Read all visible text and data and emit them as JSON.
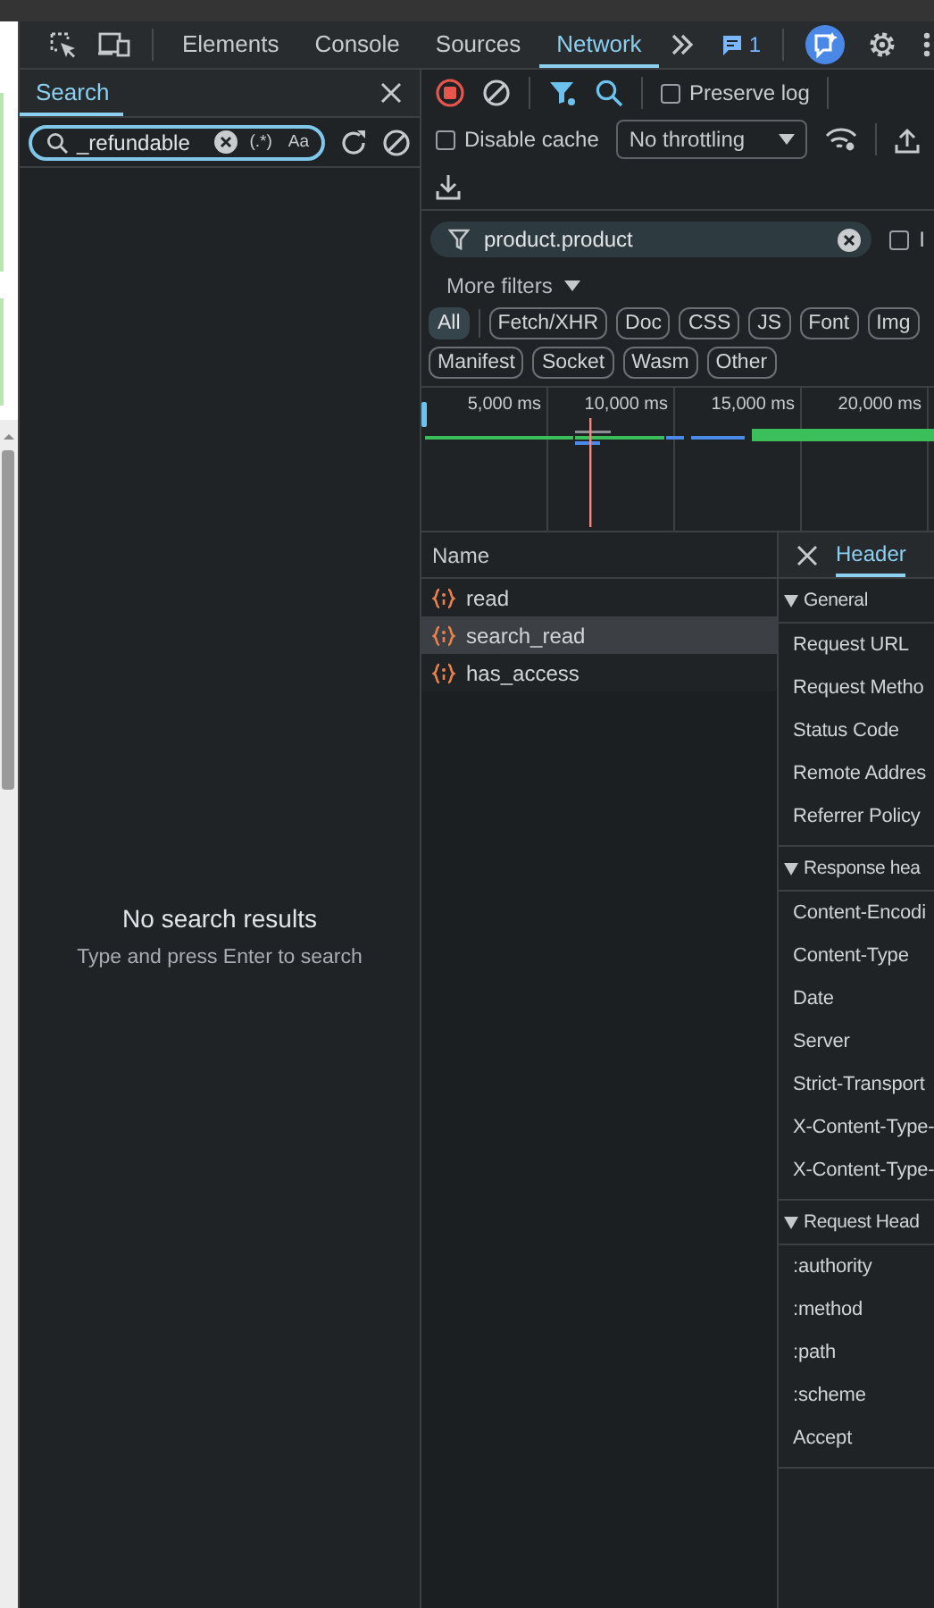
{
  "toolbar": {
    "tabs": [
      {
        "label": "Elements",
        "selected": false
      },
      {
        "label": "Console",
        "selected": false
      },
      {
        "label": "Sources",
        "selected": false
      },
      {
        "label": "Network",
        "selected": true
      }
    ],
    "message_count": "1"
  },
  "search_panel": {
    "tab": {
      "label": "Search",
      "selected": true
    },
    "query": "_refundable",
    "regex_toggle": "(.*)",
    "case_toggle": "Aa",
    "empty_title": "No search results",
    "empty_hint": "Type and press Enter to search"
  },
  "network": {
    "preserve_log": {
      "label": "Preserve log",
      "checked": false
    },
    "disable_cache": {
      "label": "Disable cache",
      "checked": false
    },
    "throttling": "No throttling",
    "filter": {
      "value": "product.product"
    },
    "invert": {
      "label": "I",
      "checked": false
    },
    "more_filters": "More filters",
    "type_filters": [
      {
        "label": "All",
        "selected": true
      },
      {
        "label": "Fetch/XHR",
        "selected": false
      },
      {
        "label": "Doc",
        "selected": false
      },
      {
        "label": "CSS",
        "selected": false
      },
      {
        "label": "JS",
        "selected": false
      },
      {
        "label": "Font",
        "selected": false
      },
      {
        "label": "Img",
        "selected": false
      },
      {
        "label": "Manifest",
        "selected": false
      },
      {
        "label": "Socket",
        "selected": false
      },
      {
        "label": "Wasm",
        "selected": false
      },
      {
        "label": "Other",
        "selected": false
      }
    ],
    "timeline_ticks": [
      "5,000 ms",
      "10,000 ms",
      "15,000 ms",
      "20,000 ms"
    ],
    "requests": {
      "column": "Name",
      "rows": [
        {
          "name": "read",
          "selected": false
        },
        {
          "name": "search_read",
          "selected": true
        },
        {
          "name": "has_access",
          "selected": false
        }
      ]
    },
    "details": {
      "tab": {
        "label": "Header",
        "selected": true
      },
      "sections": [
        {
          "title": "General",
          "expanded": true,
          "rows": [
            "Request URL",
            "Request Metho",
            "Status Code",
            "Remote Addres",
            "Referrer Policy"
          ]
        },
        {
          "title": "Response hea",
          "expanded": true,
          "rows": [
            "Content-Encodi",
            "Content-Type",
            "Date",
            "Server",
            "Strict-Transport",
            "X-Content-Type-",
            "X-Content-Type-"
          ]
        },
        {
          "title": "Request Head",
          "expanded": true,
          "rows": [
            ":authority",
            ":method",
            ":path",
            ":scheme",
            "Accept"
          ]
        }
      ]
    }
  }
}
